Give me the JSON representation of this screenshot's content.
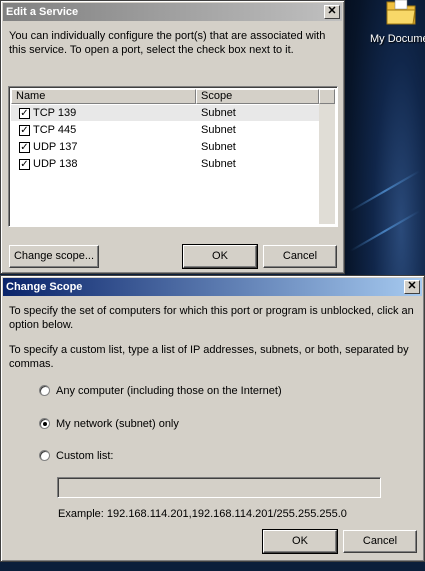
{
  "desktop": {
    "icon_label": "My Docume",
    "icon_name": "folder-icon"
  },
  "edit_service": {
    "title": "Edit a Service",
    "close_glyph": "✕",
    "description": "You can individually configure the port(s) that are associated with this service. To open a port, select the check box next to it.",
    "columns": [
      "Name",
      "Scope"
    ],
    "ports": [
      {
        "name": "TCP 139",
        "scope": "Subnet",
        "checked": true
      },
      {
        "name": "TCP 445",
        "scope": "Subnet",
        "checked": true
      },
      {
        "name": "UDP 137",
        "scope": "Subnet",
        "checked": true
      },
      {
        "name": "UDP 138",
        "scope": "Subnet",
        "checked": true
      }
    ],
    "check_glyph": "✓",
    "change_scope_label": "Change scope...",
    "ok_label": "OK",
    "cancel_label": "Cancel"
  },
  "change_scope": {
    "title": "Change Scope",
    "close_glyph": "✕",
    "instruction1": "To specify the set of computers for which this port or program is unblocked, click an option below.",
    "instruction2": "To specify a custom list, type a list of IP addresses, subnets, or both, separated by commas.",
    "options": [
      {
        "label": "Any computer (including those on the Internet)",
        "selected": false
      },
      {
        "label": "My network (subnet) only",
        "selected": true
      },
      {
        "label": "Custom list:",
        "selected": false
      }
    ],
    "custom_list_value": "",
    "custom_list_placeholder": "",
    "example": "Example: 192.168.114.201,192.168.114.201/255.255.255.0",
    "ok_label": "OK",
    "cancel_label": "Cancel"
  },
  "colors": {
    "active_title_start": "#0a246a",
    "active_title_end": "#a6caf0",
    "inactive_title_start": "#808080",
    "inactive_title_end": "#c0c0c0",
    "dialog_face": "#d4d0c8"
  }
}
